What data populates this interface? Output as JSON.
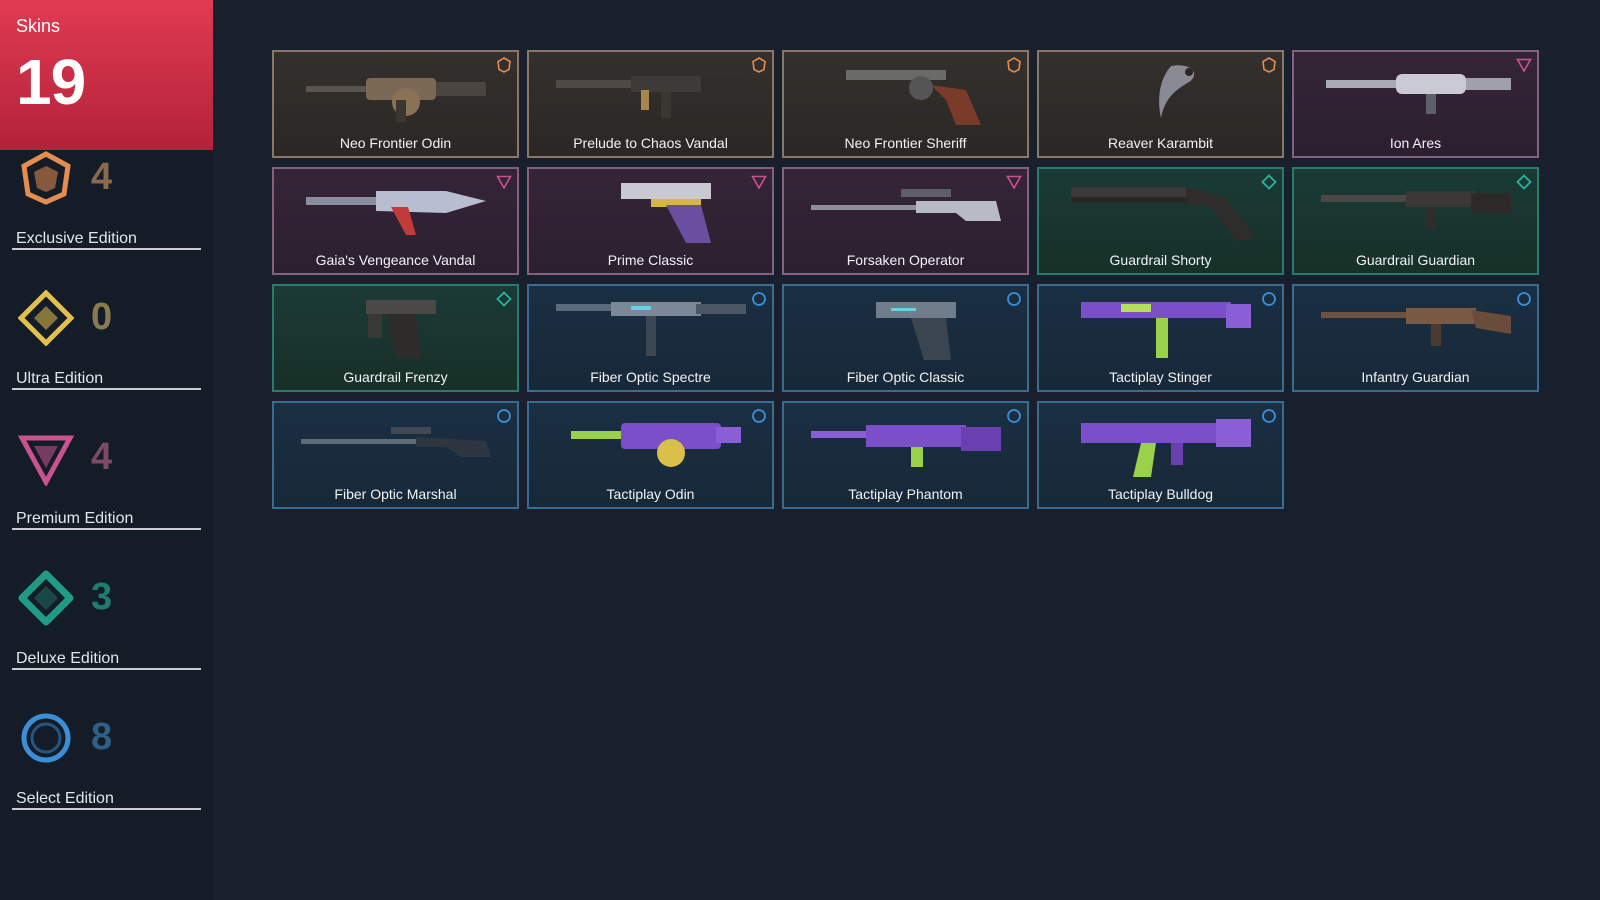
{
  "summary": {
    "label": "Skins",
    "total": "19",
    "accent_color": "#d6304a"
  },
  "tiers": [
    {
      "name": "Exclusive Edition",
      "count": "4",
      "icon": "exclusive-edition-icon",
      "color": "#e58d4f"
    },
    {
      "name": "Ultra Edition",
      "count": "0",
      "icon": "ultra-edition-icon",
      "color": "#e3c04d"
    },
    {
      "name": "Premium Edition",
      "count": "4",
      "icon": "premium-edition-icon",
      "color": "#c8538f"
    },
    {
      "name": "Deluxe Edition",
      "count": "3",
      "icon": "deluxe-edition-icon",
      "color": "#1f9b86"
    },
    {
      "name": "Select Edition",
      "count": "8",
      "icon": "select-edition-icon",
      "color": "#3a8fd8"
    }
  ],
  "skins": [
    {
      "name": "Neo Frontier Odin",
      "tier": "exclusive"
    },
    {
      "name": "Prelude to Chaos Vandal",
      "tier": "exclusive"
    },
    {
      "name": "Neo Frontier Sheriff",
      "tier": "exclusive"
    },
    {
      "name": "Reaver Karambit",
      "tier": "exclusive"
    },
    {
      "name": "Ion Ares",
      "tier": "premium"
    },
    {
      "name": "Gaia's Vengeance Vandal",
      "tier": "premium"
    },
    {
      "name": "Prime Classic",
      "tier": "premium"
    },
    {
      "name": "Forsaken Operator",
      "tier": "premium"
    },
    {
      "name": "Guardrail Shorty",
      "tier": "deluxe"
    },
    {
      "name": "Guardrail Guardian",
      "tier": "deluxe"
    },
    {
      "name": "Guardrail Frenzy",
      "tier": "deluxe"
    },
    {
      "name": "Fiber Optic Spectre",
      "tier": "select"
    },
    {
      "name": "Fiber Optic Classic",
      "tier": "select"
    },
    {
      "name": "Tactiplay Stinger",
      "tier": "select"
    },
    {
      "name": "Infantry Guardian",
      "tier": "select"
    },
    {
      "name": "Fiber Optic Marshal",
      "tier": "select"
    },
    {
      "name": "Tactiplay Odin",
      "tier": "select"
    },
    {
      "name": "Tactiplay Phantom",
      "tier": "select"
    },
    {
      "name": "Tactiplay Bulldog",
      "tier": "select"
    }
  ]
}
